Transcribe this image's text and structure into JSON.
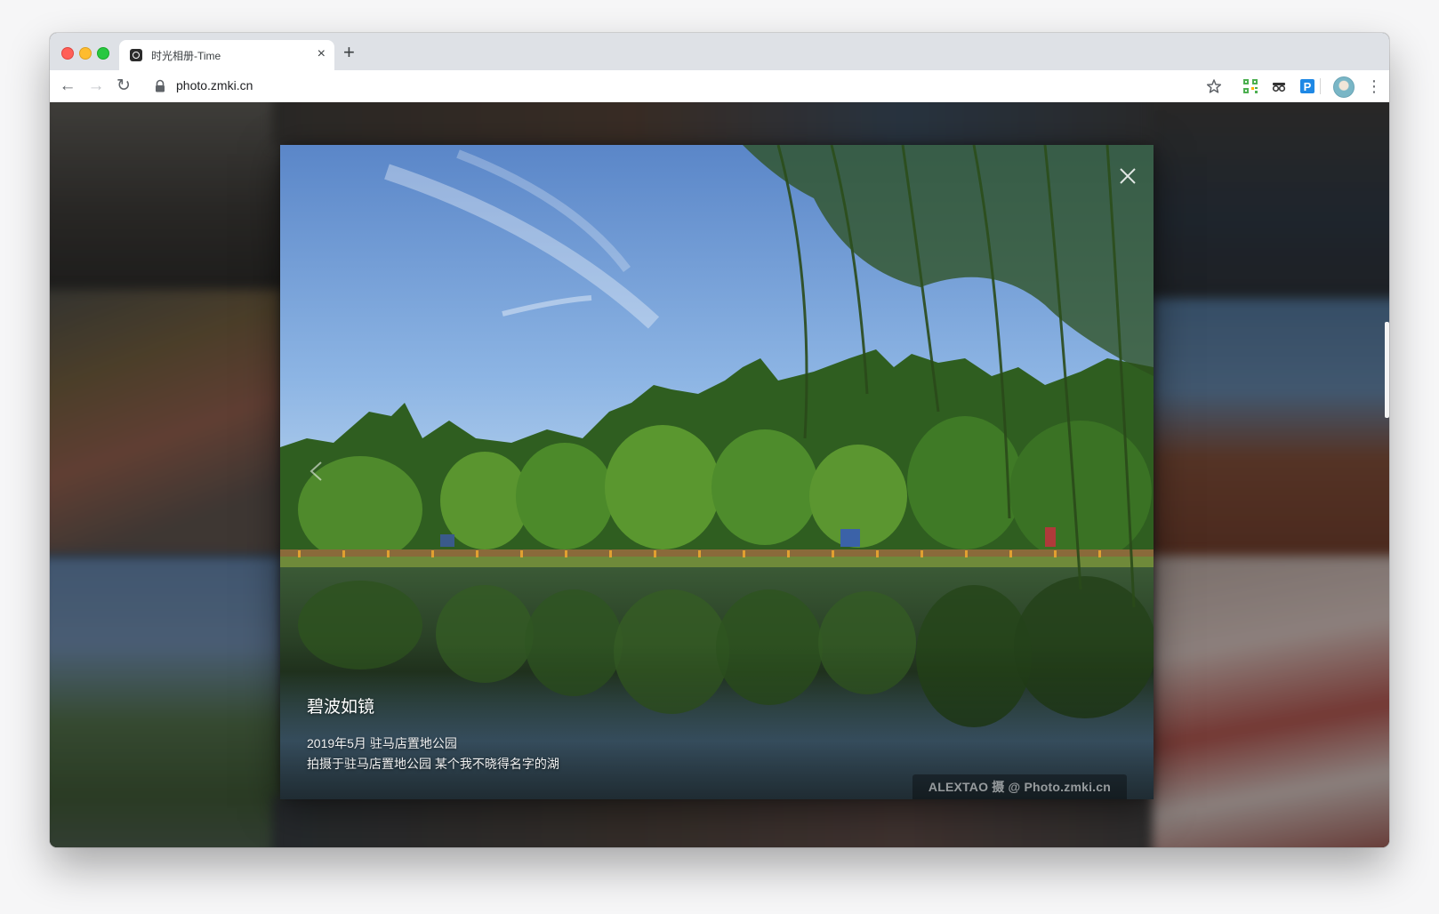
{
  "browser": {
    "tab": {
      "title": "时光相册-Time",
      "close_glyph": "×"
    },
    "new_tab_glyph": "+",
    "url": "photo.zmki.cn",
    "nav": {
      "back": "←",
      "forward": "→",
      "reload": "↻"
    },
    "menu_glyph": "⋮",
    "toolbar_icons": [
      "star-icon",
      "qr-code-extension-icon",
      "incognito-extension-icon",
      "p-extension-icon",
      "profile-avatar",
      "menu-icon"
    ],
    "p_extension_label": "P"
  },
  "lightbox": {
    "title": "碧波如镜",
    "date_location": "2019年5月 驻马店置地公园",
    "description": "拍摄于驻马店置地公园 某个我不晓得名字的湖",
    "watermark": "ALEXTAO 摄 @ Photo.zmki.cn"
  },
  "colors": {
    "tabstrip": "#dee1e6",
    "sky_top": "#5a86c8",
    "foliage": "#3b6b26",
    "extension_p": "#1e88e5"
  }
}
